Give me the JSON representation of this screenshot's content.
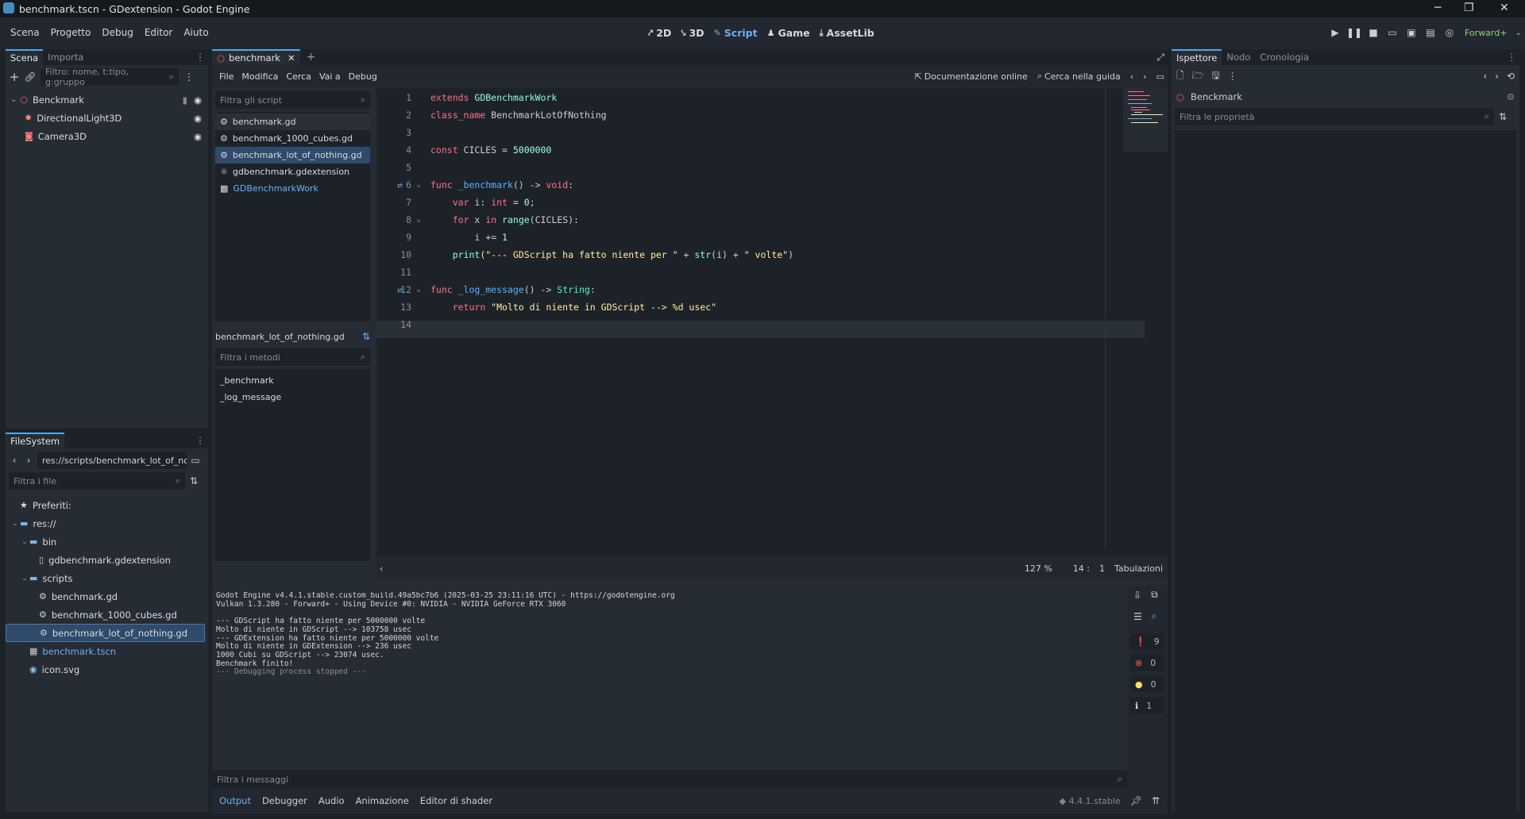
{
  "window": {
    "title": "benchmark.tscn - GDextension - Godot Engine"
  },
  "menu": [
    "Scena",
    "Progetto",
    "Debug",
    "Editor",
    "Aiuto"
  ],
  "workspaces": [
    {
      "label": "2D",
      "icon": "2d-icon"
    },
    {
      "label": "3D",
      "icon": "3d-icon"
    },
    {
      "label": "Script",
      "icon": "script-icon",
      "active": true
    },
    {
      "label": "Game",
      "icon": "game-icon"
    },
    {
      "label": "AssetLib",
      "icon": "assetlib-icon"
    }
  ],
  "renderer": "Forward+",
  "scene_dock": {
    "tabs": [
      "Scena",
      "Importa"
    ],
    "filter_placeholder": "Filtro: nome, t:tipo, g:gruppo",
    "nodes": [
      {
        "label": "Benckmark",
        "icon": "node-icon",
        "color": "#ff5f5f"
      },
      {
        "label": "DirectionalLight3D",
        "icon": "light-icon",
        "color": "#fc7f7f"
      },
      {
        "label": "Camera3D",
        "icon": "camera-icon",
        "color": "#fc7f7f"
      }
    ]
  },
  "filesystem": {
    "tab": "FileSystem",
    "path": "res://scripts/benchmark_lot_of_nothin",
    "filter_placeholder": "Filtra i file",
    "items": [
      {
        "label": "Preferiti:",
        "icon": "star-icon",
        "indent": 0
      },
      {
        "label": "res://",
        "icon": "folder-icon",
        "indent": 0
      },
      {
        "label": "bin",
        "icon": "folder-icon",
        "indent": 1
      },
      {
        "label": "gdbenchmark.gdextension",
        "icon": "file-icon",
        "indent": 2
      },
      {
        "label": "scripts",
        "icon": "folder-icon",
        "indent": 1
      },
      {
        "label": "benchmark.gd",
        "icon": "gear-icon",
        "indent": 2
      },
      {
        "label": "benchmark_1000_cubes.gd",
        "icon": "gear-icon",
        "indent": 2
      },
      {
        "label": "benchmark_lot_of_nothing.gd",
        "icon": "gear-icon",
        "indent": 2,
        "selected": true
      },
      {
        "label": "benchmark.tscn",
        "icon": "scene-icon",
        "indent": 1,
        "link": true
      },
      {
        "label": "icon.svg",
        "icon": "image-icon",
        "indent": 1
      }
    ]
  },
  "script_editor": {
    "tab": "benchmark",
    "menu": [
      "File",
      "Modifica",
      "Cerca",
      "Vai a",
      "Debug"
    ],
    "online_docs": "Documentazione online",
    "search_help": "Cerca nella guida",
    "scripts_filter": "Filtra gli script",
    "scripts": [
      {
        "label": "benchmark.gd",
        "icon": "gear-icon"
      },
      {
        "label": "benchmark_1000_cubes.gd",
        "icon": "gear-icon"
      },
      {
        "label": "benchmark_lot_of_nothing.gd",
        "icon": "gear-icon",
        "selected": true
      },
      {
        "label": "gdbenchmark.gdextension",
        "icon": "extension-icon"
      },
      {
        "label": "GDBenchmarkWork",
        "icon": "class-icon",
        "link": true
      }
    ],
    "current_script": "benchmark_lot_of_nothing.gd",
    "methods_filter": "Filtra i metodi",
    "methods": [
      "_benchmark",
      "_log_message"
    ],
    "status": {
      "zoom": "127 %",
      "line": "14 :",
      "col": "1",
      "indent": "Tabulazioni"
    }
  },
  "code": [
    [
      [
        "kw",
        "extends "
      ],
      [
        "cls",
        "GDBenchmarkWork"
      ]
    ],
    [
      [
        "kw",
        "class_name "
      ],
      [
        "plain",
        "BenchmarkLotOfNothing"
      ]
    ],
    [],
    [
      [
        "kw",
        "const "
      ],
      [
        "plain",
        "CICLES = "
      ],
      [
        "num",
        "5000000"
      ]
    ],
    [],
    [
      [
        "kw",
        "func "
      ],
      [
        "fn",
        "_benchmark"
      ],
      [
        "plain",
        "() -> "
      ],
      [
        "kw",
        "void"
      ],
      [
        "plain",
        ":"
      ]
    ],
    [
      [
        "plain",
        "    "
      ],
      [
        "kw",
        "var "
      ],
      [
        "plain",
        "i: "
      ],
      [
        "kw",
        "int"
      ],
      [
        "plain",
        " = "
      ],
      [
        "num",
        "0"
      ],
      [
        "plain",
        ";"
      ]
    ],
    [
      [
        "plain",
        "    "
      ],
      [
        "kw",
        "for "
      ],
      [
        "plain",
        "x "
      ],
      [
        "kw",
        "in "
      ],
      [
        "bi",
        "range"
      ],
      [
        "plain",
        "(CICLES):"
      ]
    ],
    [
      [
        "plain",
        "        i += "
      ],
      [
        "num",
        "1"
      ]
    ],
    [
      [
        "plain",
        "    "
      ],
      [
        "bi",
        "print"
      ],
      [
        "str",
        "(\"--- GDScript ha fatto niente per \" "
      ],
      [
        "plain",
        "+ "
      ],
      [
        "bi",
        "str"
      ],
      [
        "plain",
        "(i) + "
      ],
      [
        "str",
        "\" volte\""
      ],
      [
        "plain",
        ")"
      ]
    ],
    [],
    [
      [
        "kw",
        "func "
      ],
      [
        "fn",
        "_log_message"
      ],
      [
        "plain",
        "() -> "
      ],
      [
        "ty",
        "String"
      ],
      [
        "plain",
        ":"
      ]
    ],
    [
      [
        "plain",
        "    "
      ],
      [
        "kw",
        "return "
      ],
      [
        "str",
        "\"Molto di niente in GDScript --> %d usec\""
      ]
    ],
    []
  ],
  "output": {
    "lines": [
      "Godot Engine v4.4.1.stable.custom_build.49a5bc7b6 (2025-03-25 23:11:16 UTC) - https://godotengine.org",
      "Vulkan 1.3.280 - Forward+ - Using Device #0: NVIDIA - NVIDIA GeForce RTX 3060",
      "",
      "--- GDScript ha fatto niente per 5000000 volte",
      "Molto di niente in GDScript --> 103758 usec",
      "--- GDExtension ha fatto niente per 5000000 volte",
      "Molto di niente in GDExtension --> 236 usec",
      "1000 Cubi su GDScript --> 23074 usec.",
      "Benchmark finito!",
      "--- Debugging process stopped ---"
    ],
    "filter_placeholder": "Filtra i messaggi",
    "counters": [
      {
        "icon": "message-icon",
        "value": "9",
        "color": "#e0e0e0"
      },
      {
        "icon": "error-icon",
        "value": "0",
        "color": "#ff5d5d"
      },
      {
        "icon": "warning-icon",
        "value": "0",
        "color": "#ffdd65"
      },
      {
        "icon": "info-icon",
        "value": "1",
        "color": "#e0e0e0"
      }
    ]
  },
  "bottom_tabs": [
    "Output",
    "Debugger",
    "Audio",
    "Animazione",
    "Editor di shader"
  ],
  "version": "4.4.1.stable",
  "inspector": {
    "tabs": [
      "Ispettore",
      "Nodo",
      "Cronologia"
    ],
    "node": "Benckmark",
    "filter_placeholder": "Filtra le proprietà"
  }
}
